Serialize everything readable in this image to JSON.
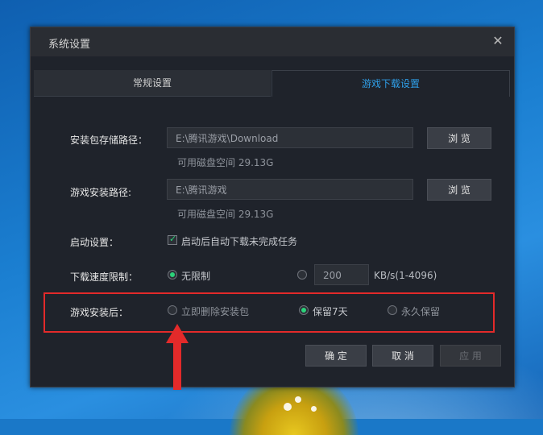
{
  "dialog": {
    "title": "系统设置"
  },
  "tabs": [
    {
      "label": "常规设置",
      "active": false
    },
    {
      "label": "游戏下载设置",
      "active": true
    }
  ],
  "package_path": {
    "label": "安装包存储路径：",
    "value": "E:\\腾讯游戏\\Download",
    "free_space": "可用磁盘空间 29.13G",
    "browse_label": "浏 览"
  },
  "install_path": {
    "label": "游戏安装路径:",
    "value": "E:\\腾讯游戏",
    "free_space": "可用磁盘空间 29.13G",
    "browse_label": "浏 览"
  },
  "startup": {
    "label": "启动设置：",
    "checkbox_label": "启动后自动下载未完成任务",
    "checked": true
  },
  "speed_limit": {
    "label": "下载速度限制：",
    "unlimited_label": "无限制",
    "selected": "unlimited",
    "value": "200",
    "unit": "KB/s(1-4096)"
  },
  "after_install": {
    "label": "游戏安装后：",
    "options": [
      {
        "label": "立即删除安装包",
        "selected": false
      },
      {
        "label": "保留7天",
        "selected": true
      },
      {
        "label": "永久保留",
        "selected": false
      }
    ]
  },
  "footer": {
    "ok_label": "确 定",
    "cancel_label": "取 消",
    "apply_label": "应 用"
  },
  "colors": {
    "accent": "#2f9fe8",
    "check_green": "#2bd27a",
    "highlight_red": "#e32a2a"
  }
}
